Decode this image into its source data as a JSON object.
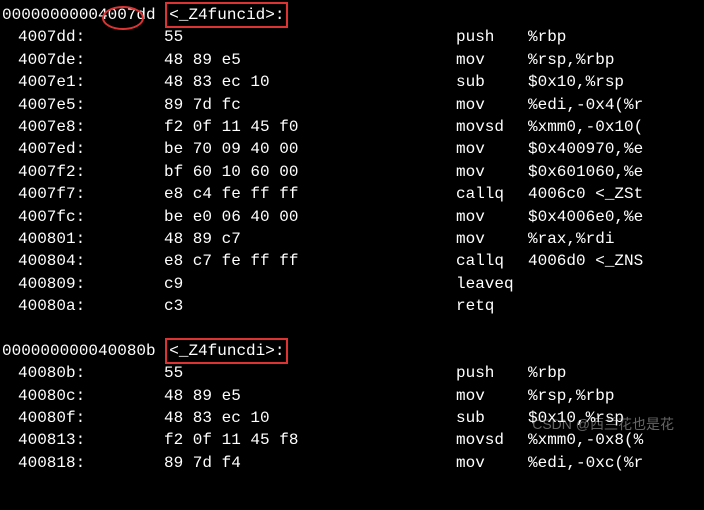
{
  "func1": {
    "addr_prefix": "000000000",
    "addr_highlight": "04007dd",
    "label": "<_Z4funcid>:"
  },
  "func2": {
    "addr": "000000000040080b",
    "label": "<_Z4funcdi>:"
  },
  "rows1": [
    {
      "addr": "4007dd:",
      "hex": "55",
      "mn": "push",
      "op": "%rbp"
    },
    {
      "addr": "4007de:",
      "hex": "48 89 e5",
      "mn": "mov",
      "op": "%rsp,%rbp"
    },
    {
      "addr": "4007e1:",
      "hex": "48 83 ec 10",
      "mn": "sub",
      "op": "$0x10,%rsp"
    },
    {
      "addr": "4007e5:",
      "hex": "89 7d fc",
      "mn": "mov",
      "op": "%edi,-0x4(%r"
    },
    {
      "addr": "4007e8:",
      "hex": "f2 0f 11 45 f0",
      "mn": "movsd",
      "op": "%xmm0,-0x10("
    },
    {
      "addr": "4007ed:",
      "hex": "be 70 09 40 00",
      "mn": "mov",
      "op": "$0x400970,%e"
    },
    {
      "addr": "4007f2:",
      "hex": "bf 60 10 60 00",
      "mn": "mov",
      "op": "$0x601060,%e"
    },
    {
      "addr": "4007f7:",
      "hex": "e8 c4 fe ff ff",
      "mn": "callq",
      "op": "4006c0 <_ZSt"
    },
    {
      "addr": "4007fc:",
      "hex": "be e0 06 40 00",
      "mn": "mov",
      "op": "$0x4006e0,%e"
    },
    {
      "addr": "400801:",
      "hex": "48 89 c7",
      "mn": "mov",
      "op": "%rax,%rdi"
    },
    {
      "addr": "400804:",
      "hex": "e8 c7 fe ff ff",
      "mn": "callq",
      "op": "4006d0 <_ZNS"
    },
    {
      "addr": "400809:",
      "hex": "c9",
      "mn": "leaveq",
      "op": ""
    },
    {
      "addr": "40080a:",
      "hex": "c3",
      "mn": "retq",
      "op": ""
    }
  ],
  "rows2": [
    {
      "addr": "40080b:",
      "hex": "55",
      "mn": "push",
      "op": "%rbp"
    },
    {
      "addr": "40080c:",
      "hex": "48 89 e5",
      "mn": "mov",
      "op": "%rsp,%rbp"
    },
    {
      "addr": "40080f:",
      "hex": "48 83 ec 10",
      "mn": "sub",
      "op": "$0x10,%rsp"
    },
    {
      "addr": "400813:",
      "hex": "f2 0f 11 45 f8",
      "mn": "movsd",
      "op": "%xmm0,-0x8(%"
    },
    {
      "addr": "400818:",
      "hex": "89 7d f4",
      "mn": "mov",
      "op": "%edi,-0xc(%r"
    }
  ],
  "watermark": "CSDN @西兰花也是花"
}
